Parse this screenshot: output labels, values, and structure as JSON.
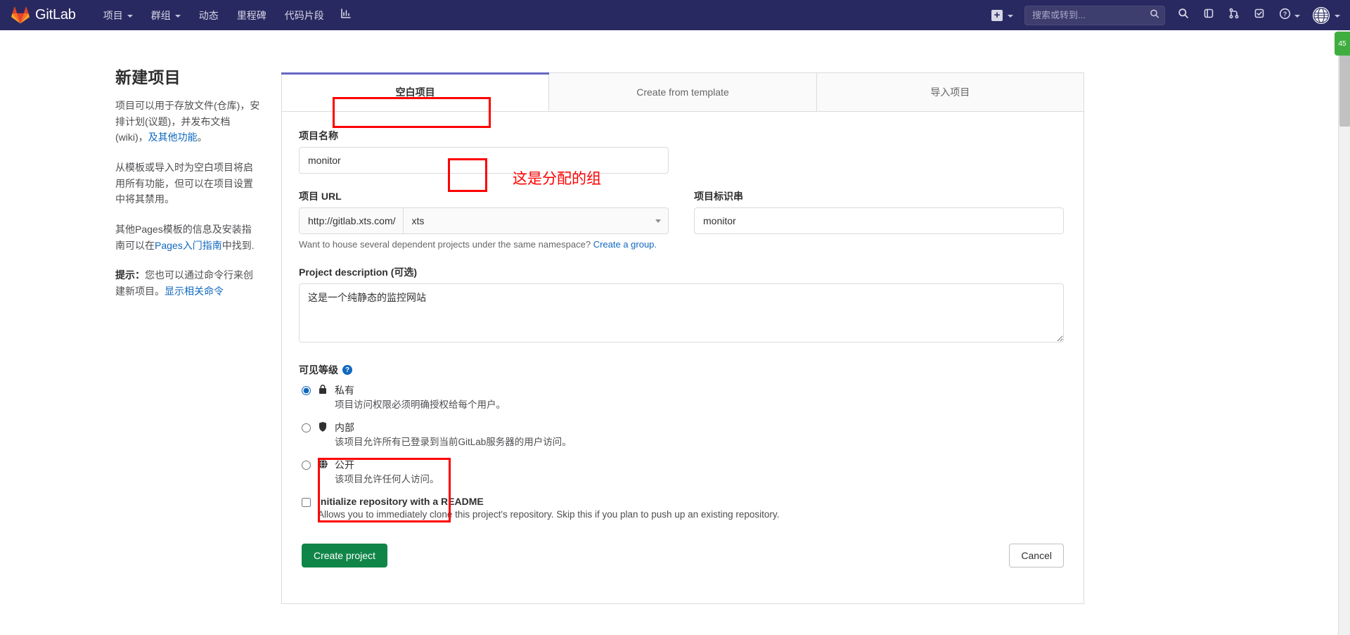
{
  "navbar": {
    "brand": "GitLab",
    "items": [
      {
        "label": "项目",
        "has_caret": true
      },
      {
        "label": "群组",
        "has_caret": true
      },
      {
        "label": "动态",
        "has_caret": false
      },
      {
        "label": "里程碑",
        "has_caret": false
      },
      {
        "label": "代码片段",
        "has_caret": false
      }
    ],
    "analytics_icon": "analytics-chart-icon",
    "plus_icon": "plus-square-icon",
    "search_placeholder": "搜索或转到...",
    "search_value": "",
    "right_icons": [
      {
        "name": "search-icon"
      },
      {
        "name": "issues-icon"
      },
      {
        "name": "merge-requests-icon"
      },
      {
        "name": "todos-icon"
      },
      {
        "name": "help-icon"
      }
    ],
    "avatar_icon": "globe-avatar-icon"
  },
  "left_panel": {
    "title": "新建项目",
    "p1_a": "项目可以用于存放文件(仓库)，安排计划(议题)，并发布文档(wiki)，",
    "p1_link": "及其他功能",
    "p1_b": "。",
    "p2": "从模板或导入时为空白项目将启用所有功能，但可以在项目设置中将其禁用。",
    "p3_a": "其他Pages模板的信息及安装指南可以在",
    "p3_link": "Pages入门指南",
    "p3_b": "中找到.",
    "tip_label": "提示：",
    "tip_text": "您也可以通过命令行来创建新项目。",
    "tip_link": "显示相关命令"
  },
  "tabs": [
    {
      "label": "空白项目",
      "active": true
    },
    {
      "label": "Create from template",
      "active": false
    },
    {
      "label": "导入项目",
      "active": false
    }
  ],
  "form": {
    "project_name_label": "项目名称",
    "project_name_value": "monitor",
    "project_url_label": "项目 URL",
    "url_prefix": "http://gitlab.xts.com/",
    "url_namespace": "xts",
    "project_slug_label": "项目标识串",
    "project_slug_value": "monitor",
    "namespace_help_a": "Want to house several dependent projects under the same namespace?",
    "namespace_help_link": "Create a group.",
    "description_label": "Project description (可选)",
    "description_value": "这是一个纯静态的监控网站",
    "visibility_label": "可见等级",
    "visibility_help_glyph": "?",
    "visibility_options": [
      {
        "name": "私有",
        "desc": "项目访问权限必须明确授权给每个用户。",
        "icon": "lock-icon",
        "selected": true
      },
      {
        "name": "内部",
        "desc": "该项目允许所有已登录到当前GitLab服务器的用户访问。",
        "icon": "shield-icon",
        "selected": false
      },
      {
        "name": "公开",
        "desc": "该项目允许任何人访问。",
        "icon": "globe-icon",
        "selected": false
      }
    ],
    "readme_label": "Initialize repository with a README",
    "readme_desc": "Allows you to immediately clone this project's repository. Skip this if you plan to push up an existing repository.",
    "readme_checked": false,
    "create_button": "Create project",
    "cancel_button": "Cancel"
  },
  "annotations": {
    "group_note": "这是分配的组",
    "color": "#ff0000"
  },
  "side_tab": {
    "label": "45"
  }
}
